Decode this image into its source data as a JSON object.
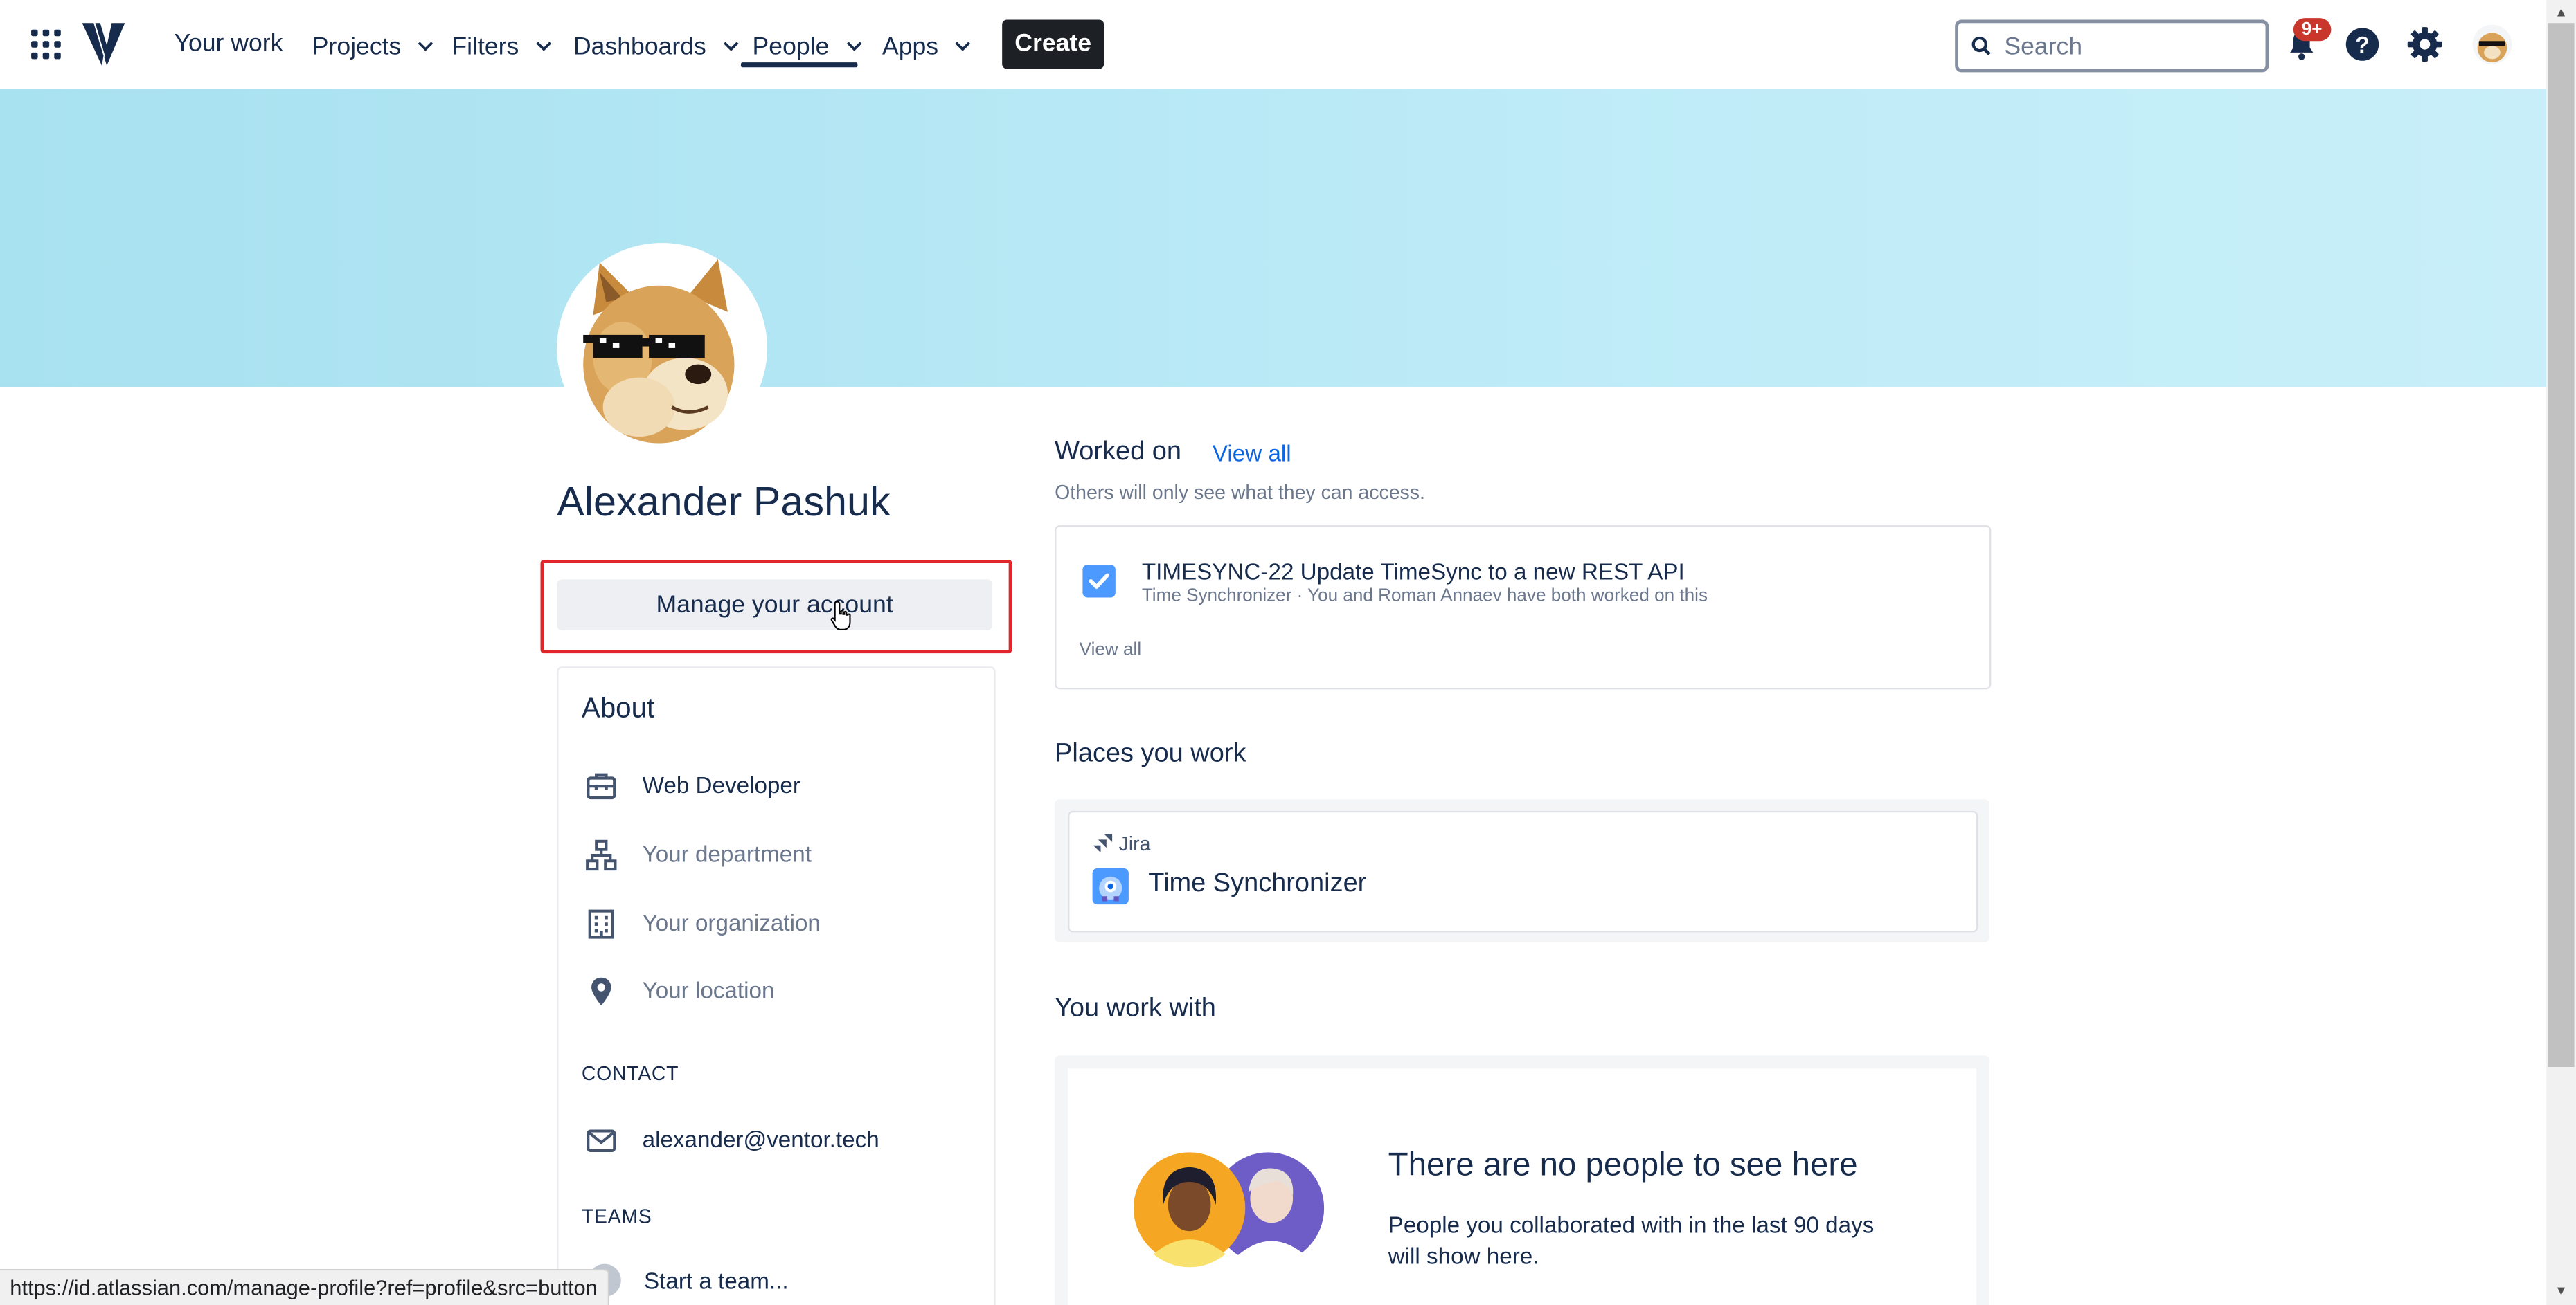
{
  "nav": {
    "items": [
      {
        "label": "Your work",
        "has_chevron": false
      },
      {
        "label": "Projects",
        "has_chevron": true
      },
      {
        "label": "Filters",
        "has_chevron": true
      },
      {
        "label": "Dashboards",
        "has_chevron": true
      },
      {
        "label": "People",
        "has_chevron": true,
        "active": true
      },
      {
        "label": "Apps",
        "has_chevron": true
      }
    ],
    "create_label": "Create",
    "search_placeholder": "Search",
    "notifications_badge": "9+",
    "icons": [
      "app-switcher-icon",
      "logo-icon",
      "search-icon",
      "notifications-icon",
      "help-icon",
      "settings-icon",
      "avatar"
    ]
  },
  "profile": {
    "name": "Alexander Pashuk",
    "manage_label": "Manage your account",
    "about_title": "About",
    "about": [
      {
        "icon": "briefcase-icon",
        "text": "Web Developer",
        "placeholder": false
      },
      {
        "icon": "department-icon",
        "text": "Your department",
        "placeholder": true
      },
      {
        "icon": "organization-icon",
        "text": "Your organization",
        "placeholder": true
      },
      {
        "icon": "location-icon",
        "text": "Your location",
        "placeholder": true
      }
    ],
    "contact_label": "CONTACT",
    "email": "alexander@ventor.tech",
    "teams_label": "TEAMS",
    "start_team": "Start a team..."
  },
  "worked_on": {
    "title": "Worked on",
    "view_all": "View all",
    "subtitle": "Others will only see what they can access.",
    "item_title": "TIMESYNC-22 Update TimeSync to a new REST API",
    "item_meta": "Time Synchronizer · You and Roman Annaev have both worked on this",
    "card_view_all": "View all"
  },
  "places": {
    "title": "Places you work",
    "product": "Jira",
    "project": "Time Synchronizer"
  },
  "work_with": {
    "title": "You work with",
    "empty_title": "There are no people to see here",
    "empty_desc": "People you collaborated with in the last 90 days will show here."
  },
  "status_url": "https://id.atlassian.com/manage-profile?ref=profile&src=button",
  "colors": {
    "banner": "#bdebf7",
    "create_button": "#1d2125",
    "highlight_border": "#e0262b",
    "link": "#0c66e4",
    "checkbox": "#4c9aff"
  }
}
